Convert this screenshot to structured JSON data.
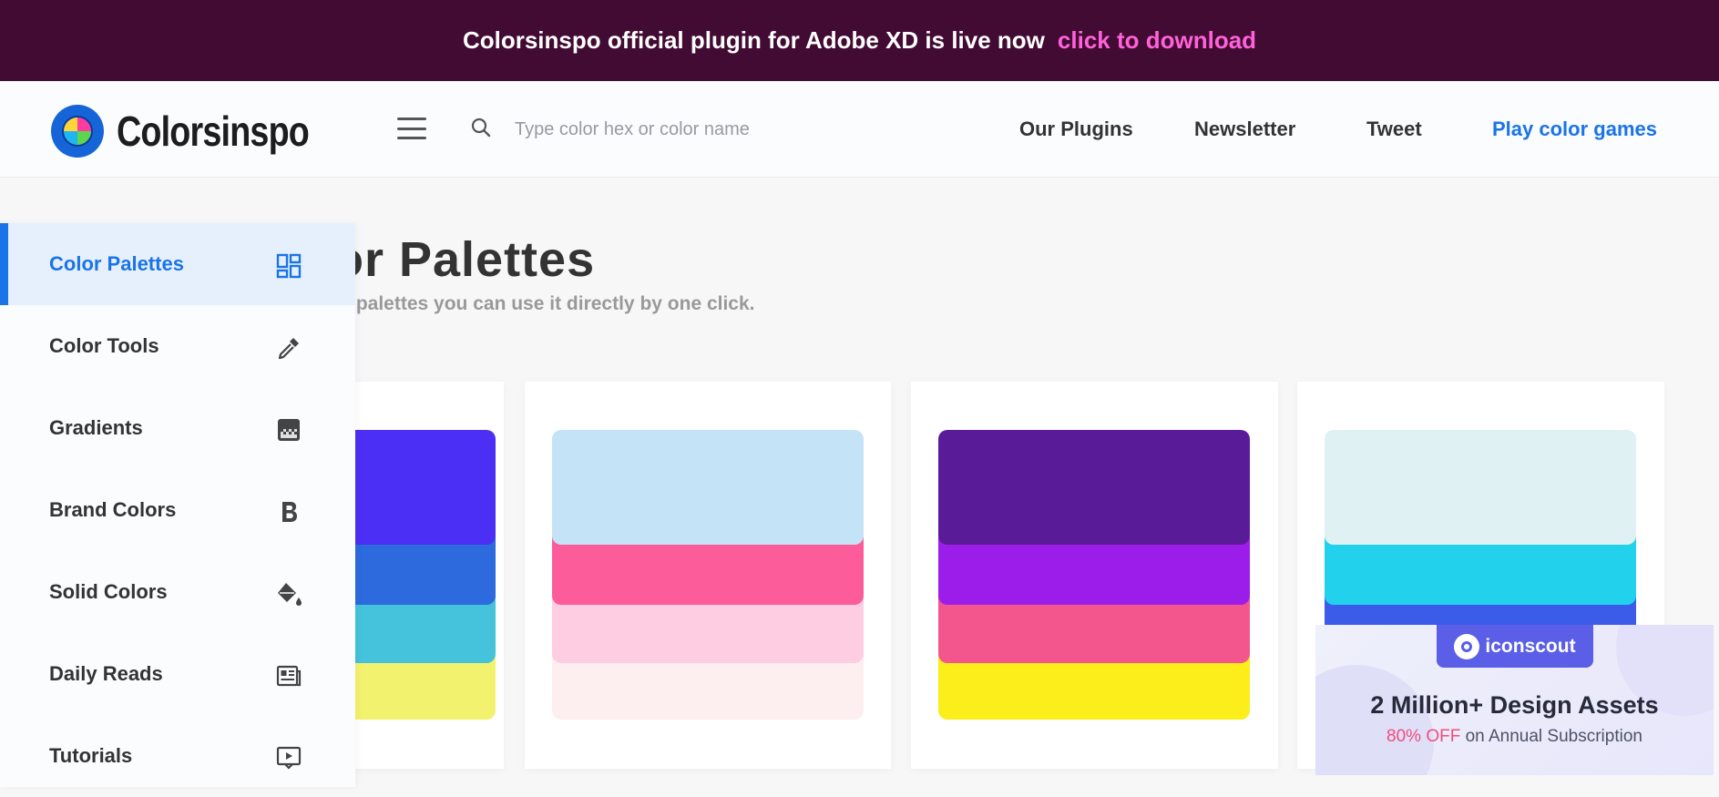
{
  "banner": {
    "message": "Colorsinspo official plugin for Adobe XD is live now",
    "link_text": "click to download"
  },
  "header": {
    "brand": "Colorsinspo",
    "search_placeholder": "Type color hex or color name",
    "nav": [
      "Our Plugins",
      "Newsletter",
      "Tweet",
      "Play color games"
    ]
  },
  "sidebar": {
    "items": [
      {
        "label": "Color Palettes",
        "icon": "dashboard-icon",
        "active": true
      },
      {
        "label": "Color Tools",
        "icon": "eyedropper-icon"
      },
      {
        "label": "Gradients",
        "icon": "gradient-icon"
      },
      {
        "label": "Brand Colors",
        "icon": "bold-b-icon"
      },
      {
        "label": "Solid Colors",
        "icon": "paint-bucket-icon"
      },
      {
        "label": "Daily Reads",
        "icon": "article-icon"
      },
      {
        "label": "Tutorials",
        "icon": "video-play-icon"
      }
    ]
  },
  "main": {
    "title": "olor Palettes",
    "subtitle": "l color palettes you can use it directly by one click."
  },
  "palettes": [
    [
      "#4b2ff5",
      "#2c6ade",
      "#45c2dc",
      "#f2f26e"
    ],
    [
      "#c5e3f6",
      "#fd5c9a",
      "#fecde1",
      "#fdefef"
    ],
    [
      "#5a1b98",
      "#9c1de9",
      "#f3558d",
      "#fbee1a"
    ],
    [
      "#dff1f3",
      "#22d2ec",
      "#3a5ce8",
      "#ffffff"
    ]
  ],
  "ad": {
    "brand": "iconscout",
    "title": "2 Million+ Design Assets",
    "discount": "80% OFF",
    "subtitle_rest": " on Annual Subscription"
  },
  "colors": {
    "banner_bg": "#420b33",
    "link_pink": "#ff62d8",
    "accent_blue": "#1a74e8"
  }
}
